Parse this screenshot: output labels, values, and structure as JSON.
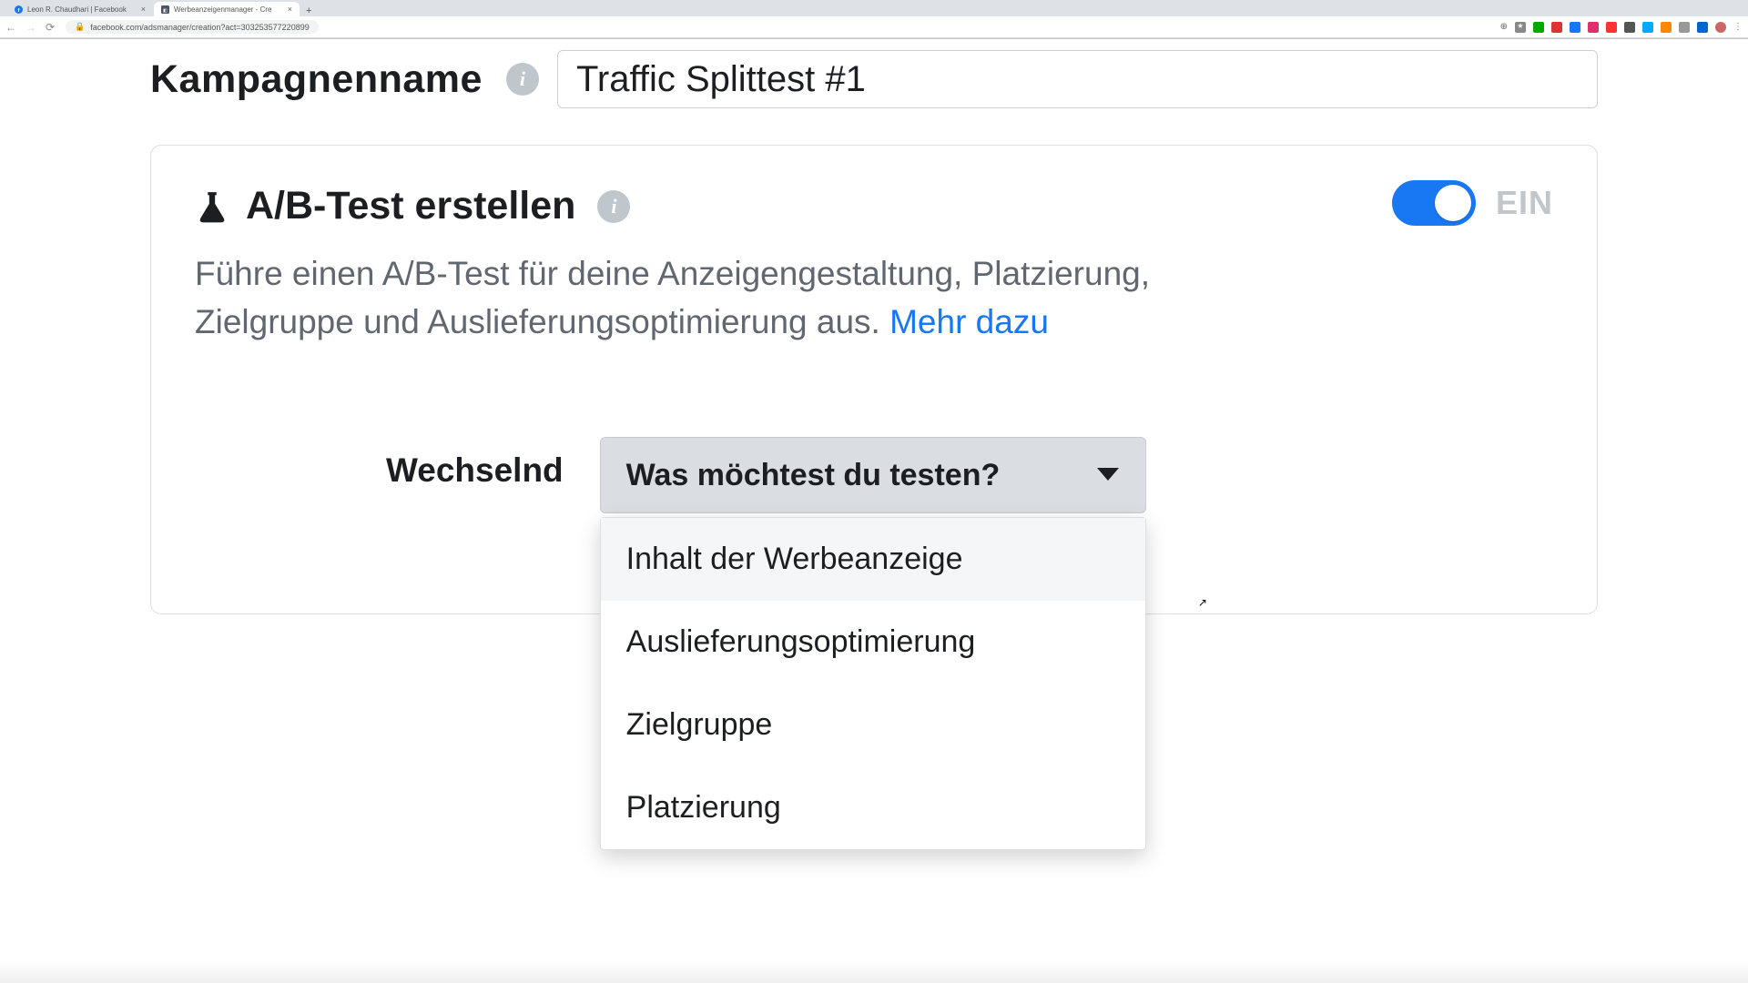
{
  "browser": {
    "tabs": [
      {
        "title": "Leon R. Chaudhari | Facebook",
        "active": false
      },
      {
        "title": "Werbeanzeigenmanager - Cre",
        "active": true
      }
    ],
    "url": "facebook.com/adsmanager/creation?act=303253577220899"
  },
  "campaign": {
    "label": "Kampagnenname",
    "input_value": "Traffic Splittest #1"
  },
  "ab_test": {
    "title": "A/B-Test erstellen",
    "description": "Führe einen A/B-Test für deine Anzeigengestaltung, Platzierung, Zielgruppe und Auslieferungsoptimierung aus. ",
    "more_link": "Mehr dazu",
    "toggle_state": "EIN",
    "alternating_label": "Wechselnd",
    "select_placeholder": "Was möchtest du testen?",
    "options": [
      "Inhalt der Werbeanzeige",
      "Auslieferungsoptimierung",
      "Zielgruppe",
      "Platzierung"
    ]
  }
}
